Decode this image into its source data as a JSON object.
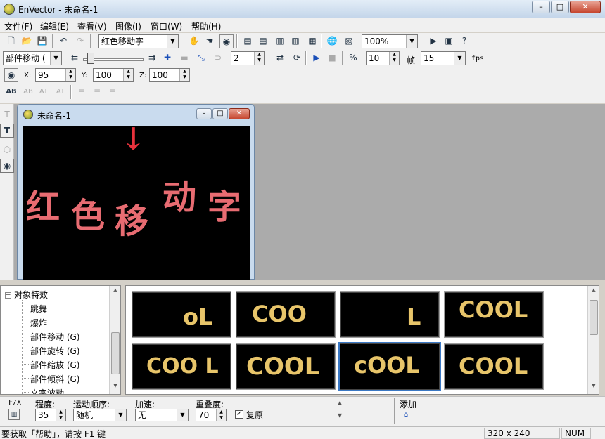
{
  "window": {
    "title": "EnVector - 未命名-1",
    "min": "–",
    "max": "□",
    "close": "✕"
  },
  "menu": [
    "文件(F)",
    "编辑(E)",
    "查看(V)",
    "图像(I)",
    "窗口(W)",
    "帮助(H)"
  ],
  "toolbar": {
    "text_combo": "红色移动字",
    "zoom_combo": "100%",
    "effect_combo": "部件移动 (",
    "steps_value": "2",
    "frames_value": "10",
    "frames_label": "帧",
    "fps_value": "15",
    "fps_label": "fps",
    "x_label": "X:",
    "x_value": "95",
    "y_label": "Y:",
    "y_value": "100",
    "z_label": "Z:",
    "z_value": "100",
    "text_tools": [
      "AB",
      "AB",
      "AT",
      "AT"
    ]
  },
  "child": {
    "title": "未命名-1",
    "canvas_text": [
      "红",
      "色",
      "移",
      "动",
      "字"
    ],
    "arrow": "↓"
  },
  "tree": {
    "root": "对象特效",
    "root_box": "−",
    "items": [
      "跳舞",
      "爆炸",
      "部件移动 (G)",
      "部件旋转 (G)",
      "部件缩放 (G)",
      "部件倾斜 (G)",
      "文字波动"
    ],
    "selected_index": 2
  },
  "gallery": {
    "tiles": [
      "oL",
      "COO",
      "L",
      "COOL",
      "COO L",
      "COOL",
      "cOOL",
      "COOL"
    ],
    "selected_index": 6
  },
  "options": {
    "fx_label": "F/X",
    "degree_label": "程度:",
    "degree_value": "35",
    "order_label": "运动顺序:",
    "order_value": "随机",
    "accel_label": "加速:",
    "accel_value": "无",
    "overlap_label": "重叠度:",
    "overlap_value": "70",
    "restore_label": "复原",
    "restore_checked": "✓",
    "add_label": "添加"
  },
  "status": {
    "help": "要获取「帮助」，请按 F1 键",
    "size": "320 x 240",
    "num": "NUM"
  },
  "colors": {
    "canvas_text": "#e86c72",
    "tile_text": "#e8c56a",
    "selection": "#3a78c4"
  }
}
